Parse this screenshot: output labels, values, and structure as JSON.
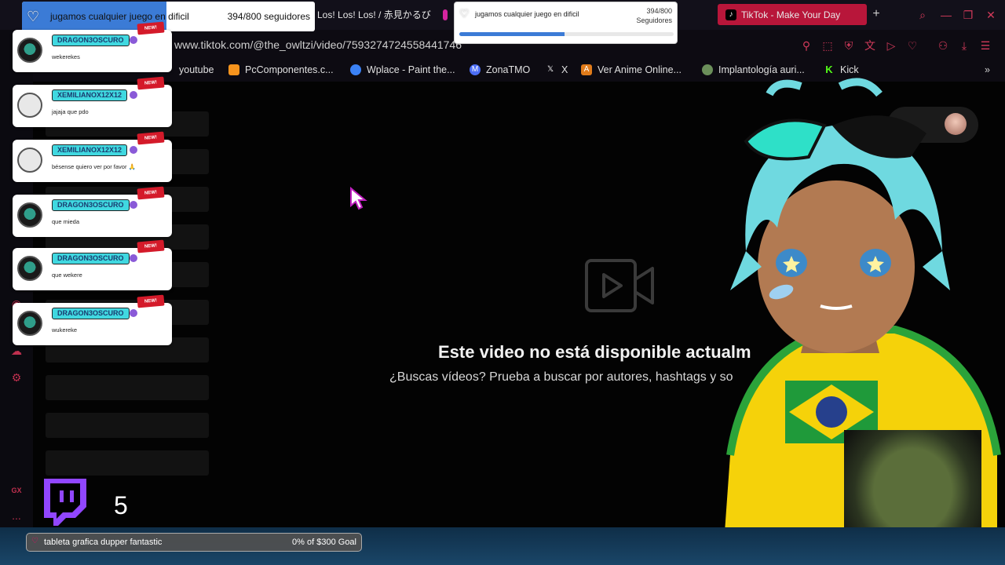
{
  "browser": {
    "tabs": [
      {
        "label": "Los! Los! Los! / 赤見かるび",
        "icon": "tab-icon"
      },
      {
        "label": "TikTok - Make Your Day",
        "icon": "tiktok-icon",
        "active": true
      }
    ],
    "new_tab": "+",
    "url": "www.tiktok.com/@the_owltzi/video/7593274724558441746",
    "bookmarks": [
      {
        "label": "youtube",
        "icon": "youtube-icon"
      },
      {
        "label": "PcComponentes.c...",
        "icon": "pccomponentes-icon",
        "color": "#f7941d"
      },
      {
        "label": "Wplace - Paint the...",
        "icon": "globe-icon",
        "color": "#3b82f6"
      },
      {
        "label": "ZonaTMO",
        "icon": "zonatmo-icon",
        "color": "#4c6ef5"
      },
      {
        "label": "X",
        "icon": "x-icon"
      },
      {
        "label": "Ver Anime Online...",
        "icon": "animeflv-icon",
        "color": "#e07b1a"
      },
      {
        "label": "Implantología auri...",
        "icon": "implant-icon",
        "color": "#6b8f5a"
      },
      {
        "label": "Kick",
        "icon": "kick-icon",
        "color": "#53fc18"
      }
    ],
    "accent": "#d23a5a"
  },
  "follower_widget_1": {
    "title": "jugamos cualquier juego en dificil",
    "count": "394/800 seguidores",
    "progress": 0.4925
  },
  "follower_widget_2": {
    "title": "jugamos cualquier juego en dificil",
    "count": "394/800",
    "count_label": "Seguidores",
    "progress": 0.4925
  },
  "chat": [
    {
      "user": "DRAGON3OSCURO",
      "message": "wekerekes",
      "avatar": "dark",
      "badge": "NEW!"
    },
    {
      "user": "XEMILIANOX12X12",
      "message": "jajaja que pdo",
      "avatar": "light",
      "badge": "NEW!"
    },
    {
      "user": "XEMILIANOX12X12",
      "message": "bésense quiero ver por favor 🙏",
      "avatar": "light",
      "badge": "NEW!"
    },
    {
      "user": "DRAGON3OSCURO",
      "message": "que mieda",
      "avatar": "dark",
      "badge": "NEW!"
    },
    {
      "user": "DRAGON3OSCURO",
      "message": "que wekere",
      "avatar": "dark",
      "badge": "NEW!"
    },
    {
      "user": "DRAGON3OSCURO",
      "message": "wukereke",
      "avatar": "dark",
      "badge": "NEW!"
    }
  ],
  "page": {
    "unavailable_title": "Este video no está disponible actualm",
    "unavailable_sub": "¿Buscas vídeos? Prueba a buscar por autores, hashtags y so"
  },
  "twitch": {
    "sub_count": "5",
    "color": "#9146ff"
  },
  "goal": {
    "label": "tableta grafica dupper fantastic",
    "progress": "0% of $300 Goal"
  },
  "sidebar": {
    "gx_label": "GX",
    "more_label": "..."
  }
}
